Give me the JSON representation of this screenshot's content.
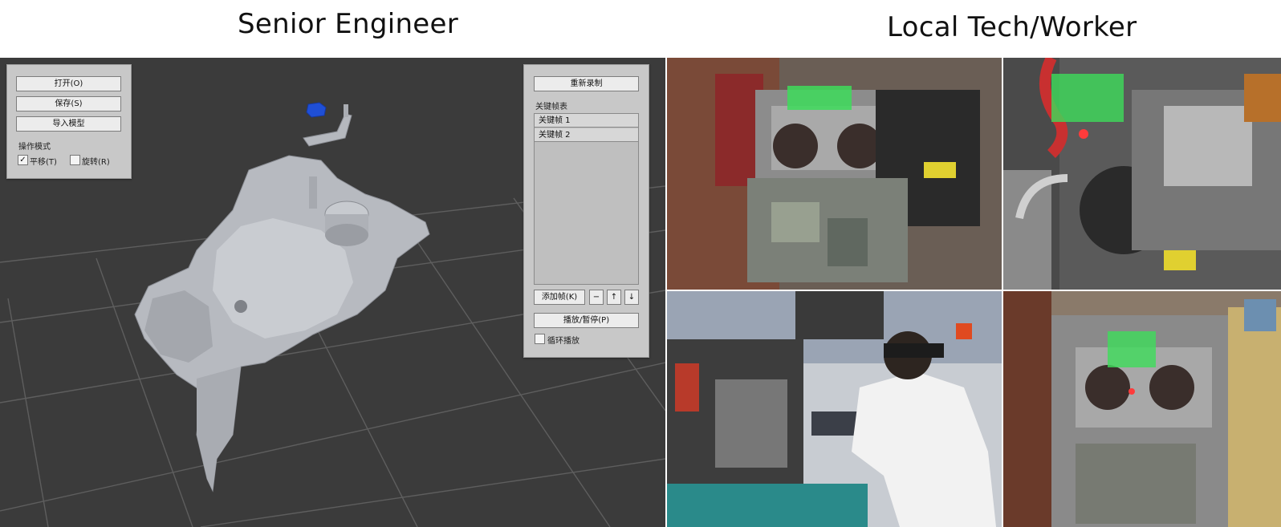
{
  "titles": {
    "left": "Senior Engineer",
    "right": "Local Tech/Worker"
  },
  "left_panel": {
    "open_label": "打开(O)",
    "save_label": "保存(S)",
    "import_label": "导入模型",
    "mode_label": "操作模式",
    "translate_label": "平移(T)",
    "rotate_label": "旋转(R)",
    "translate_checked": true,
    "rotate_checked": false
  },
  "right_panel": {
    "rerecord_label": "重新录制",
    "keyframe_list_label": "关键帧表",
    "keyframes": [
      "关键帧 1",
      "关键帧 2"
    ],
    "add_frame_label": "添加帧(K)",
    "remove_label": "−",
    "up_label": "↑",
    "down_label": "↓",
    "play_pause_label": "播放/暂停(P)",
    "loop_label": "循环播放",
    "loop_checked": false
  },
  "colors": {
    "viewport_bg": "#3b3b3b",
    "panel_bg": "#c8c8c8",
    "hologram": "#3ddc5a",
    "model": "#b9bcc2",
    "part_blue": "#1f4fd6"
  },
  "videos": [
    "hologram-view-engine-front",
    "hologram-view-engine-closeup",
    "worker-with-headset",
    "hologram-view-engine-side"
  ]
}
